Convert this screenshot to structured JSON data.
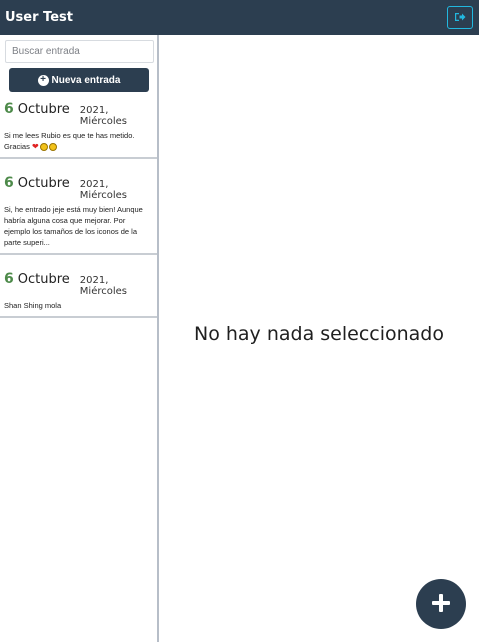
{
  "navbar": {
    "title": "User Test",
    "logout_icon": "sign-out-icon",
    "accent": "#22b8e0",
    "background": "#2c3e50"
  },
  "sidebar": {
    "search_placeholder": "Buscar entrada",
    "new_entry_label": "Nueva entrada",
    "entries": [
      {
        "day": "6",
        "month": "Octubre",
        "year_weekday": "2021, Miércoles",
        "text": "Si me lees Rubio es que te has metido. Gracias",
        "emoji": [
          "heart",
          "face",
          "face"
        ]
      },
      {
        "day": "6",
        "month": "Octubre",
        "year_weekday": "2021, Miércoles",
        "text": "Si, he entrado jeje está muy bien! Aunque habría alguna cosa que mejorar. Por ejemplo los tamaños de los iconos de la parte superi...",
        "emoji": []
      },
      {
        "day": "6",
        "month": "Octubre",
        "year_weekday": "2021, Miércoles",
        "text": "Shan Shing mola",
        "emoji": []
      }
    ]
  },
  "main": {
    "empty_message": "No hay nada seleccionado",
    "fab_icon": "plus-icon"
  }
}
